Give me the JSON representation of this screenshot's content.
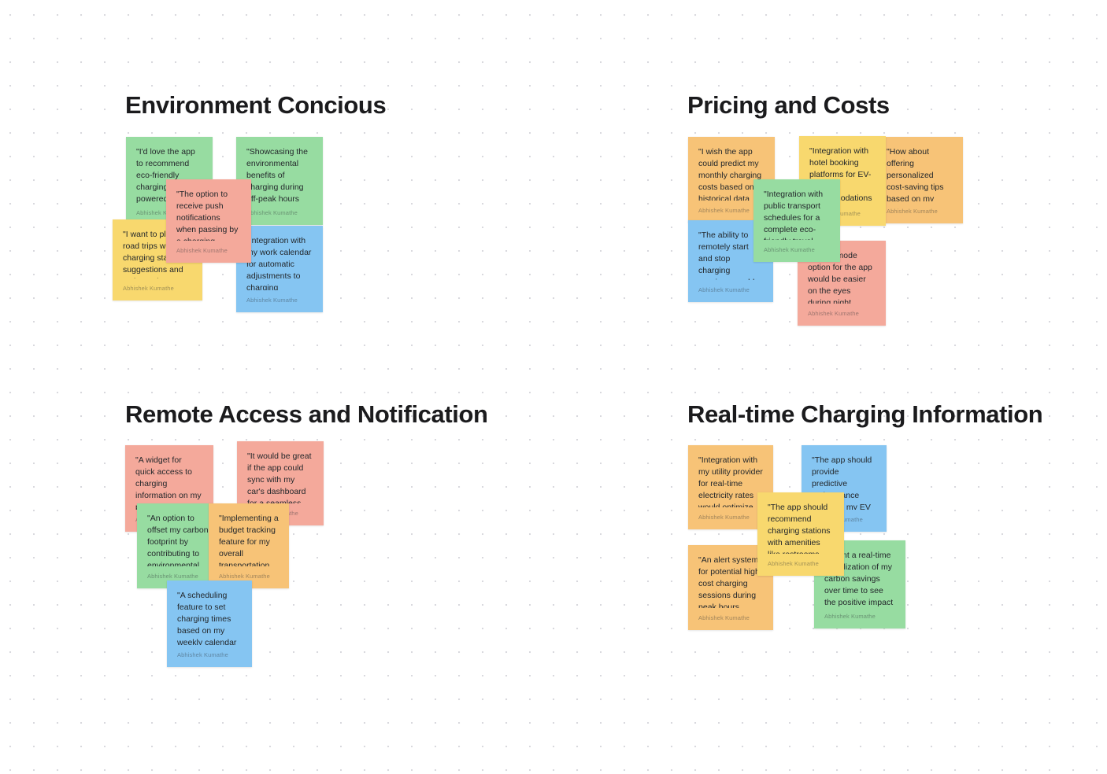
{
  "board": {
    "background_color": "#ffffff",
    "grid_dot_color": "#d9d9de",
    "title_color": "#1b1b1d",
    "palette": {
      "green": "#97dca1",
      "blue": "#85c5f2",
      "yellow": "#f8d86e",
      "salmon": "#f4a99b",
      "orange": "#f7c377"
    }
  },
  "frames": [
    {
      "id": "environment-concious",
      "title": "Environment Concious",
      "notes": [
        {
          "text": "\"I'd love the app to recommend eco-friendly charging stations powered by renewable energy.\"",
          "author": "Abhishek Kumathe",
          "color": "green"
        },
        {
          "text": "\"I want to plan my road trips with charging station suggestions and estimated charging times.\"",
          "author": "Abhishek Kumathe",
          "color": "yellow"
        },
        {
          "text": "\"The option to receive push notifications when passing by a charging station on my commute route would be helpful.\"",
          "author": "Abhishek Kumathe",
          "color": "salmon"
        },
        {
          "text": "\"Showcasing the environmental benefits of charging during off-peak hours would motivate me to adjust my charging habits.\"",
          "author": "Abhishek Kumathe",
          "color": "green"
        },
        {
          "text": "\"Integration with my work calendar for automatic adjustments to charging schedules during meetings and events would be efficient.\"",
          "author": "Abhishek Kumathe",
          "color": "blue"
        }
      ]
    },
    {
      "id": "pricing-and-costs",
      "title": "Pricing and Costs",
      "notes": [
        {
          "text": "\"I wish the app could predict my monthly charging costs based on historical data and current electricity rates.\"",
          "author": "Abhishek Kumathe",
          "color": "orange"
        },
        {
          "text": "\"The ability to remotely start and stop charging sessions would add a layer of convenience to my busy lifestyle.\"",
          "author": "Abhishek Kumathe",
          "color": "blue"
        },
        {
          "text": "\"Integration with hotel booking platforms for EV-friendly accommodations during trips would be a win.\"",
          "author": "Abhishek Kumathe",
          "color": "yellow"
        },
        {
          "text": "\"Integration with public transport schedules for a complete eco-friendly travel plan would be a game-changer.\"",
          "author": "Abhishek Kumathe",
          "color": "green"
        },
        {
          "text": "\"How about offering personalized cost-saving tips based on my charging patterns?\"",
          "author": "Abhishek Kumathe",
          "color": "orange"
        },
        {
          "text": "\"A dark mode option for the app would be easier on the eyes during night drives.\"",
          "author": "Abhishek Kumathe",
          "color": "salmon"
        }
      ]
    },
    {
      "id": "remote-access-and-notification",
      "title": "Remote Access and Notification",
      "notes": [
        {
          "text": "\"A widget for quick access to charging information on my phone's home screen would be incredibly convenient.\"",
          "author": "Abhishek Kumathe",
          "color": "salmon"
        },
        {
          "text": "\"An option to offset my carbon footprint by contributing to environmental projects would be fantastic.\"",
          "author": "Abhishek Kumathe",
          "color": "green"
        },
        {
          "text": "\"It would be great if the app could sync with my car's dashboard for a seamless charging experience.\"",
          "author": "Abhishek Kumathe",
          "color": "salmon"
        },
        {
          "text": "\"Implementing a budget tracking feature for my overall transportation expenses would be beneficial.\"",
          "author": "Abhishek Kumathe",
          "color": "orange"
        },
        {
          "text": "\"A scheduling feature to set charging times based on my weekly calendar would simplify my routine.\"",
          "author": "Abhishek Kumathe",
          "color": "blue"
        }
      ]
    },
    {
      "id": "real-time-charging-information",
      "title": "Real-time Charging Information",
      "notes": [
        {
          "text": "\"Integration with my utility provider for real-time electricity rates would optimize my charging costs.\"",
          "author": "Abhishek Kumathe",
          "color": "orange"
        },
        {
          "text": "\"An alert system for potential high-cost charging sessions during peak hours would help me avoid surprises.\"",
          "author": "Abhishek Kumathe",
          "color": "orange"
        },
        {
          "text": "\"The app should provide predictive maintenance alerts for my EV to avoid unexpected issues.\"",
          "author": "Abhishek Kumathe",
          "color": "blue"
        },
        {
          "text": "\"The app should recommend charging stations with amenities like restrooms and cafes for a comfortable travel experience.\"",
          "author": "Abhishek Kumathe",
          "color": "yellow"
        },
        {
          "text": "\"I want a real-time visualization of my carbon savings over time to see the positive impact I'm making.\"",
          "author": "Abhishek Kumathe",
          "color": "green"
        }
      ]
    }
  ]
}
